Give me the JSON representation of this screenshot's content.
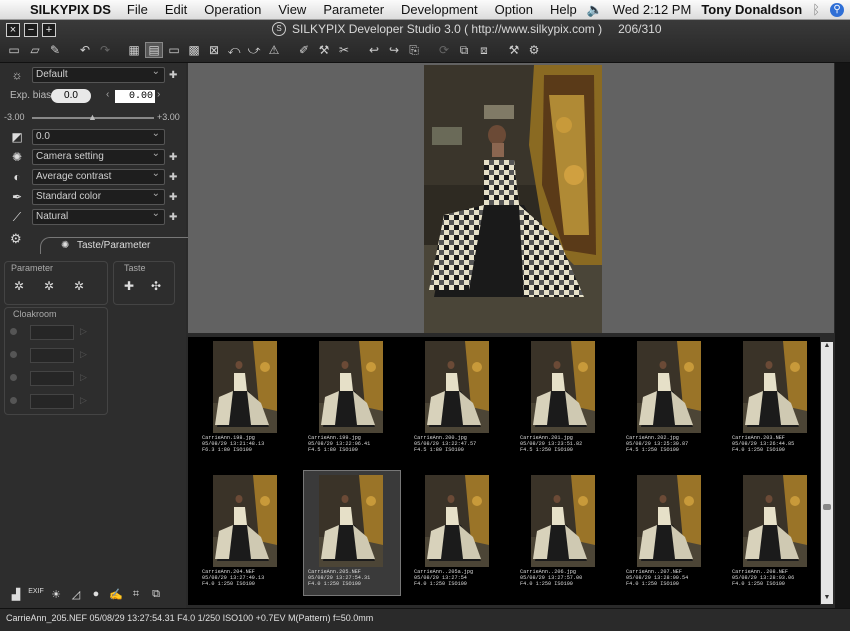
{
  "menubar": {
    "app_name": "SILKYPIX DS",
    "items": [
      "File",
      "Edit",
      "Operation",
      "View",
      "Parameter",
      "Development",
      "Option",
      "Help"
    ],
    "clock": "Wed 2:12 PM",
    "user": "Tony Donaldson"
  },
  "window": {
    "title": "SILKYPIX Developer Studio 3.0 ( http://www.silkypix.com )",
    "counter": "206/310"
  },
  "left_panel": {
    "preset": "Default",
    "exp_bias_label": "Exp. bias",
    "exp_bias_value": "0.0",
    "exp_bias_field": "0.00",
    "slider_min": "-3.00",
    "slider_max": "+3.00",
    "slider_level": 0.5,
    "white_balance": "0.0",
    "camera_setting": "Camera setting",
    "contrast": "Average contrast",
    "color": "Standard color",
    "sharpness": "Natural",
    "taste_tab": "Taste/Parameter",
    "parameter_label": "Parameter",
    "taste_label": "Taste",
    "cloakroom_label": "Cloakroom"
  },
  "thumbnails": [
    {
      "name": "CarrieAnn.198.jpg",
      "date": "05/08/29 13:21:48.13",
      "info": "F6.3 1:80 ISO100"
    },
    {
      "name": "CarrieAnn.199.jpg",
      "date": "05/08/29 13:22:06.41",
      "info": "F4.5 1:80 ISO100"
    },
    {
      "name": "CarrieAnn.200.jpg",
      "date": "05/08/29 13:22:47.57",
      "info": "F4.5 1:80 ISO100"
    },
    {
      "name": "CarrieAnn.201.jpg",
      "date": "05/08/29 13:23:51.82",
      "info": "F4.5 1:250 ISO100"
    },
    {
      "name": "CarrieAnn.202.jpg",
      "date": "05/08/29 13:25:30.87",
      "info": "F4.5 1:250 ISO100"
    },
    {
      "name": "CarrieAnn.203.NEF",
      "date": "05/08/29 13:26:44.85",
      "info": "F4.0 1:250 ISO100"
    },
    {
      "name": "CarrieAnn.204.NEF",
      "date": "05/08/29 13:27:49.13",
      "info": "F4.0 1:250 ISO100"
    },
    {
      "name": "CarrieAnn.205.NEF",
      "date": "05/08/29 13:27:54.31",
      "info": "F4.0 1:250 ISO100"
    },
    {
      "name": "CarrieAnn..205a.jpg",
      "date": "05/08/29 13:27:54",
      "info": "F4.0 1:250 ISO100"
    },
    {
      "name": "CarrieAnn..206.jpg",
      "date": "05/08/29 13:27:57.00",
      "info": "F4.0 1:250 ISO100"
    },
    {
      "name": "CarrieAnn..207.NEF",
      "date": "05/08/29 13:28:00.54",
      "info": "F4.0 1:250 ISO100"
    },
    {
      "name": "CarrieAnn..208.NEF",
      "date": "05/08/29 13:28:03.06",
      "info": "F4.0 1:250 ISO100"
    }
  ],
  "status_bar": "CarrieAnn_205.NEF 05/08/29 13:27:54.31 F4.0 1/250 ISO100 +0.7EV M(Pattern) f=50.0mm"
}
